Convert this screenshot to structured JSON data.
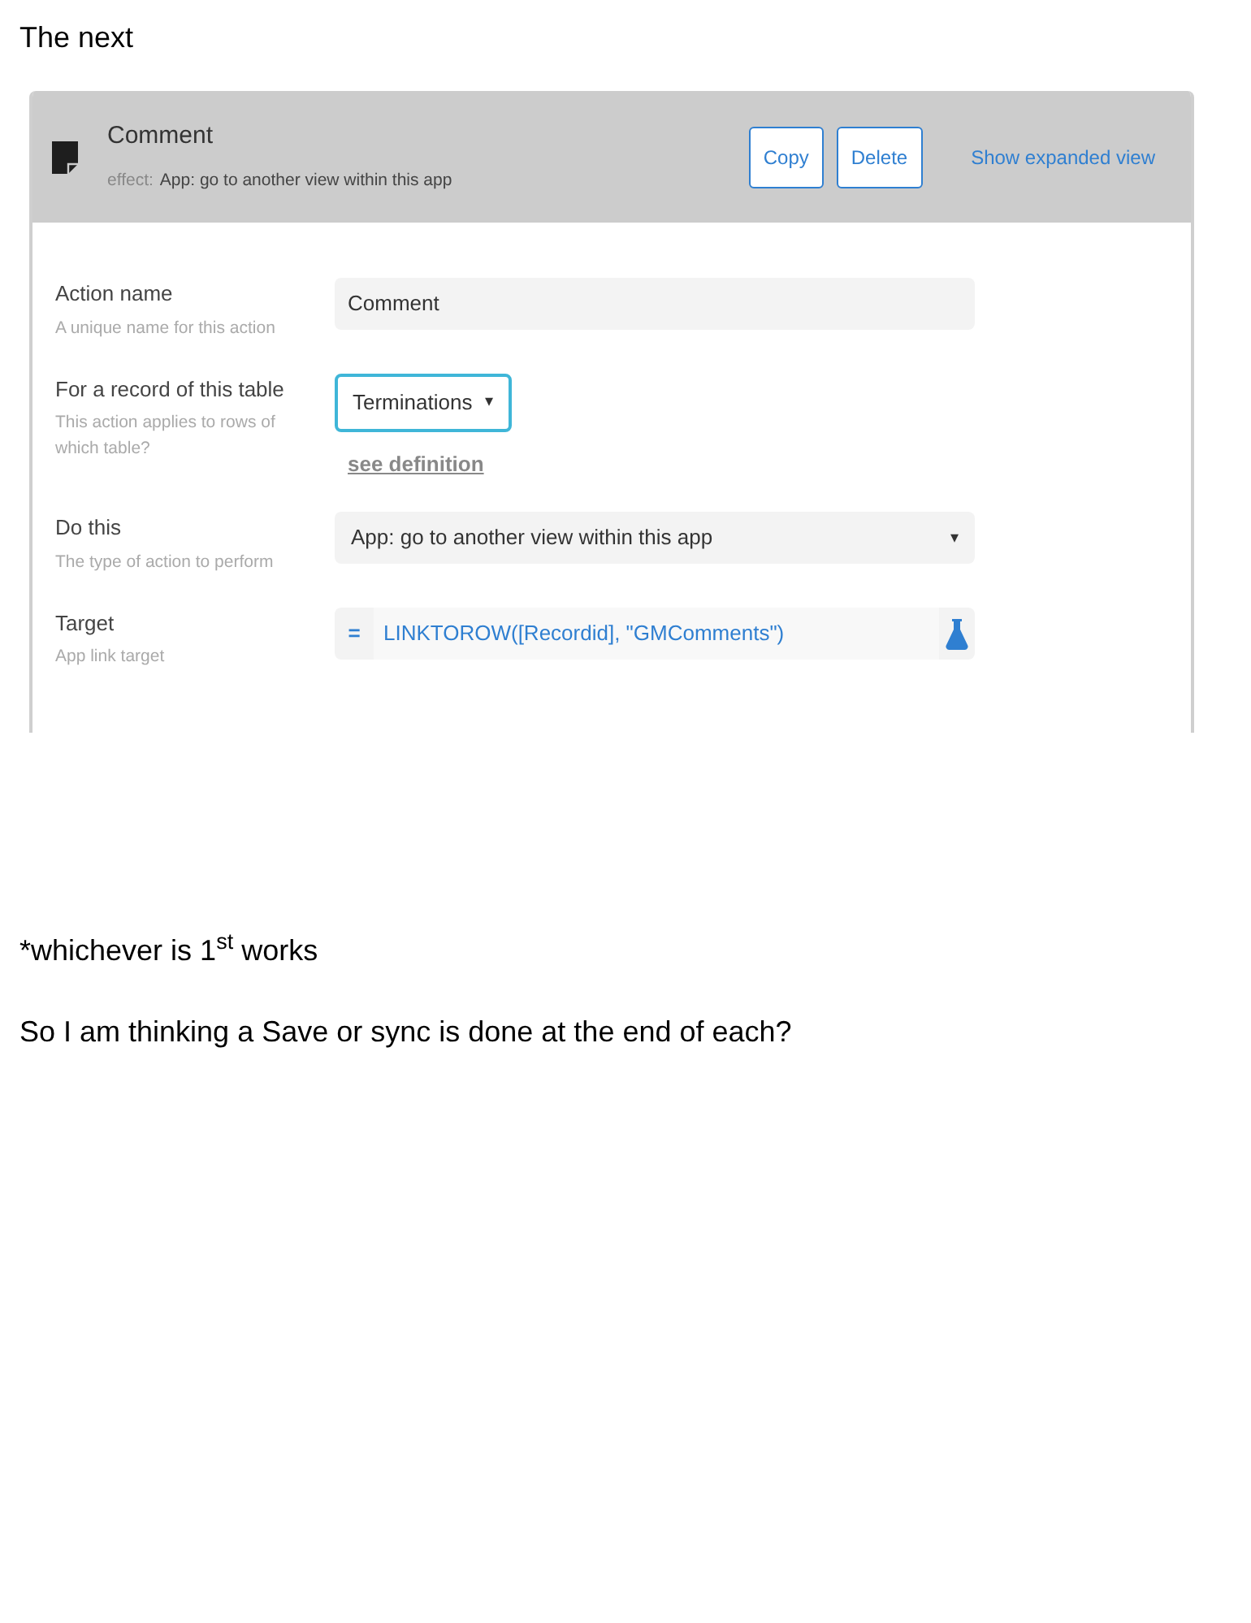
{
  "heading": "The next",
  "action_card": {
    "title": "Comment",
    "effect_label": "effect:",
    "effect_value": "App: go to another view within this app",
    "buttons": [
      "Copy",
      "Delete"
    ],
    "link": "Show expanded view",
    "fields": [
      {
        "kind": "text",
        "label": "Action name",
        "hint": "A unique name for this action",
        "value": "Comment"
      },
      {
        "kind": "select",
        "label": "For a record of this table",
        "hint": "This action applies to rows of which table?",
        "value": "Terminations",
        "caret": "▾",
        "link": "see definition"
      },
      {
        "kind": "dropdown",
        "label": "Do this",
        "hint": "The type of action to perform",
        "value": "App: go to another view within this app",
        "caret": "▾"
      },
      {
        "kind": "formula",
        "label": "Target",
        "hint": "App link target",
        "prefix": "=",
        "value": "LINKTOROW([Recordid], \"GMComments\")"
      }
    ]
  },
  "notes": [
    "*whichever is 1$^{st}$ works",
    "So I am thinking a Save or sync is done at the end of each?"
  ]
}
